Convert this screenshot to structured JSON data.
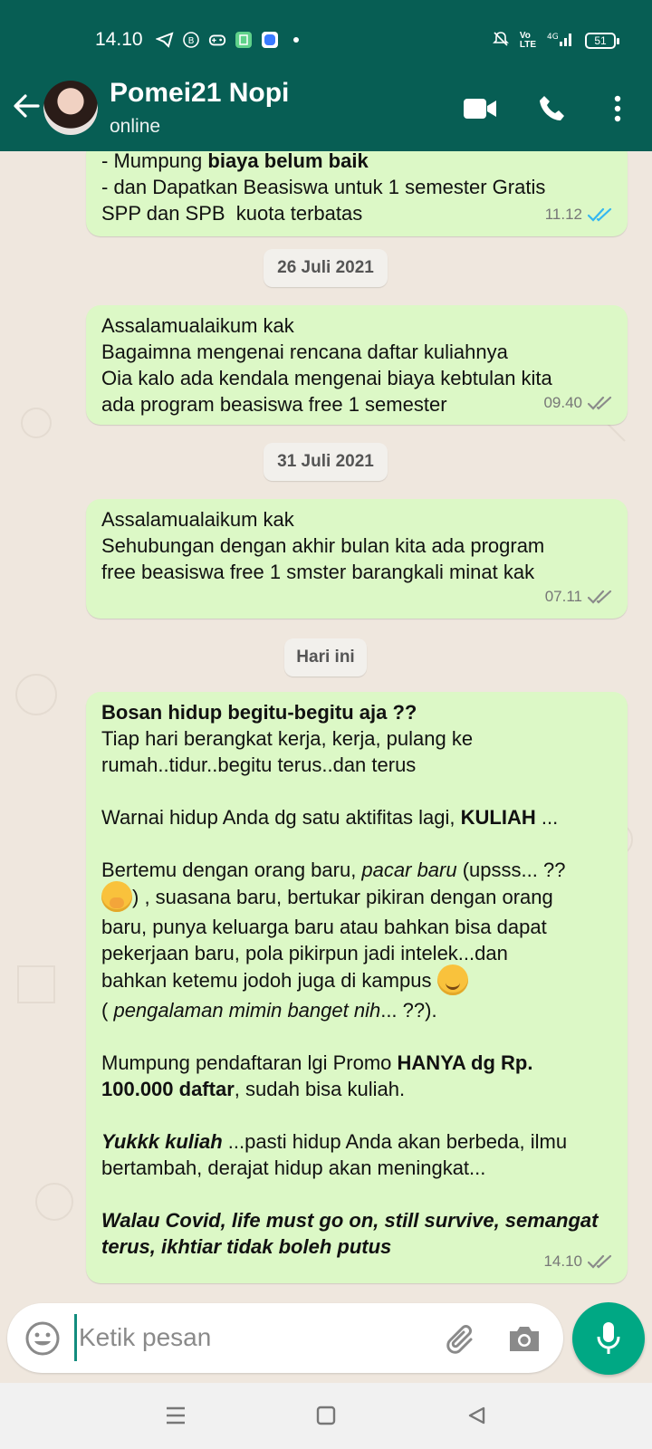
{
  "status_bar": {
    "time": "14.10",
    "left_icons": [
      "telegram-icon",
      "b-icon",
      "gamepad-icon",
      "app-icon",
      "app-blue-icon",
      "dot-icon"
    ],
    "right_icons": [
      "mute-icon",
      "volte-icon",
      "signal-4g-icon"
    ],
    "battery": "51"
  },
  "header": {
    "contact_name": "Pomei21 Nopi",
    "contact_status": "online",
    "color": "#075e54"
  },
  "messages": [
    {
      "lines": [
        {
          "parts": [
            {
              "t": "- Mumpung "
            },
            {
              "t": "biaya belum baik",
              "b": true
            }
          ]
        },
        {
          "parts": [
            {
              "t": "- dan Dapatkan Beasiswa untuk 1 semester Gratis"
            }
          ]
        },
        {
          "parts": [
            {
              "t": "SPP dan SPB  kuota terbatas"
            }
          ]
        }
      ],
      "time": "11.12",
      "status": "read"
    },
    {
      "lines": [
        {
          "parts": [
            {
              "t": "Assalamualaikum kak"
            }
          ]
        },
        {
          "parts": [
            {
              "t": "Bagaimna mengenai rencana daftar kuliahnya"
            }
          ]
        },
        {
          "parts": [
            {
              "t": "Oia kalo ada kendala mengenai biaya kebtulan kita"
            }
          ]
        },
        {
          "parts": [
            {
              "t": "ada program beasiswa free 1 semester"
            }
          ]
        }
      ],
      "time": "09.40",
      "status": "delivered"
    },
    {
      "lines": [
        {
          "parts": [
            {
              "t": "Assalamualaikum kak"
            }
          ]
        },
        {
          "parts": [
            {
              "t": "Sehubungan dengan akhir bulan kita ada program"
            }
          ]
        },
        {
          "parts": [
            {
              "t": "free beasiswa free 1 smster barangkali minat kak"
            }
          ]
        }
      ],
      "time": "07.11",
      "status": "delivered"
    },
    {
      "lines": [
        {
          "parts": [
            {
              "t": "Bosan hidup begitu-begitu aja ??",
              "b": true
            }
          ]
        },
        {
          "parts": [
            {
              "t": "Tiap hari berangkat kerja, kerja, pulang ke"
            }
          ]
        },
        {
          "parts": [
            {
              "t": "rumah..tidur..begitu terus..dan terus"
            }
          ]
        },
        {
          "parts": [
            {
              "t": " "
            }
          ]
        },
        {
          "parts": [
            {
              "t": "Warnai hidup Anda dg satu aktifitas lagi, "
            },
            {
              "t": "KULIAH",
              "b": true
            },
            {
              "t": " ..."
            }
          ]
        },
        {
          "parts": [
            {
              "t": " "
            }
          ]
        },
        {
          "parts": [
            {
              "t": "Bertemu dengan orang baru, "
            },
            {
              "t": "pacar baru",
              "i": true
            },
            {
              "t": " (upsss... ??"
            }
          ]
        },
        {
          "parts": [
            {
              "emoji": "hand-over-mouth-emoji"
            },
            {
              "t": ") , suasana baru, bertukar pikiran dengan orang"
            }
          ]
        },
        {
          "parts": [
            {
              "t": "baru, punya keluarga baru atau bahkan bisa dapat"
            }
          ]
        },
        {
          "parts": [
            {
              "t": "pekerjaan baru, pola pikirpun jadi intelek...dan"
            }
          ]
        },
        {
          "parts": [
            {
              "t": "bahkan ketemu jodoh juga di kampus "
            },
            {
              "emoji": "smiling-blush-emoji"
            }
          ]
        },
        {
          "parts": [
            {
              "t": "( "
            },
            {
              "t": "pengalaman mimin banget nih",
              "i": true
            },
            {
              "t": "... ??)."
            }
          ]
        },
        {
          "parts": [
            {
              "t": " "
            }
          ]
        },
        {
          "parts": [
            {
              "t": "Mumpung pendaftaran lgi Promo "
            },
            {
              "t": "HANYA dg Rp.",
              "b": true
            }
          ]
        },
        {
          "parts": [
            {
              "t": "100.000 daftar",
              "b": true
            },
            {
              "t": ", sudah bisa kuliah."
            }
          ]
        },
        {
          "parts": [
            {
              "t": " "
            }
          ]
        },
        {
          "parts": [
            {
              "t": "Yukkk kuliah",
              "b": true,
              "i": true
            },
            {
              "t": " ...pasti hidup Anda akan berbeda, ilmu"
            }
          ]
        },
        {
          "parts": [
            {
              "t": "bertambah, derajat hidup akan meningkat..."
            }
          ]
        },
        {
          "parts": [
            {
              "t": " "
            }
          ]
        },
        {
          "parts": [
            {
              "t": "Walau Covid, life must go on, still survive, semangat",
              "b": true,
              "i": true
            }
          ]
        },
        {
          "parts": [
            {
              "t": "terus, ikhtiar tidak boleh putus",
              "b": true,
              "i": true
            }
          ]
        }
      ],
      "time": "14.10",
      "status": "delivered"
    }
  ],
  "date_chips": [
    "26 Juli 2021",
    "31 Juli 2021",
    "Hari ini"
  ],
  "input": {
    "placeholder": "Ketik pesan"
  },
  "colors": {
    "bubble_out": "#dcf8c6",
    "tick_read": "#34b7f1",
    "tick_delivered": "#8b8b8b",
    "mic_button": "#00a884"
  },
  "navbar": [
    "menu-icon",
    "home-icon",
    "back-triangle-icon"
  ]
}
